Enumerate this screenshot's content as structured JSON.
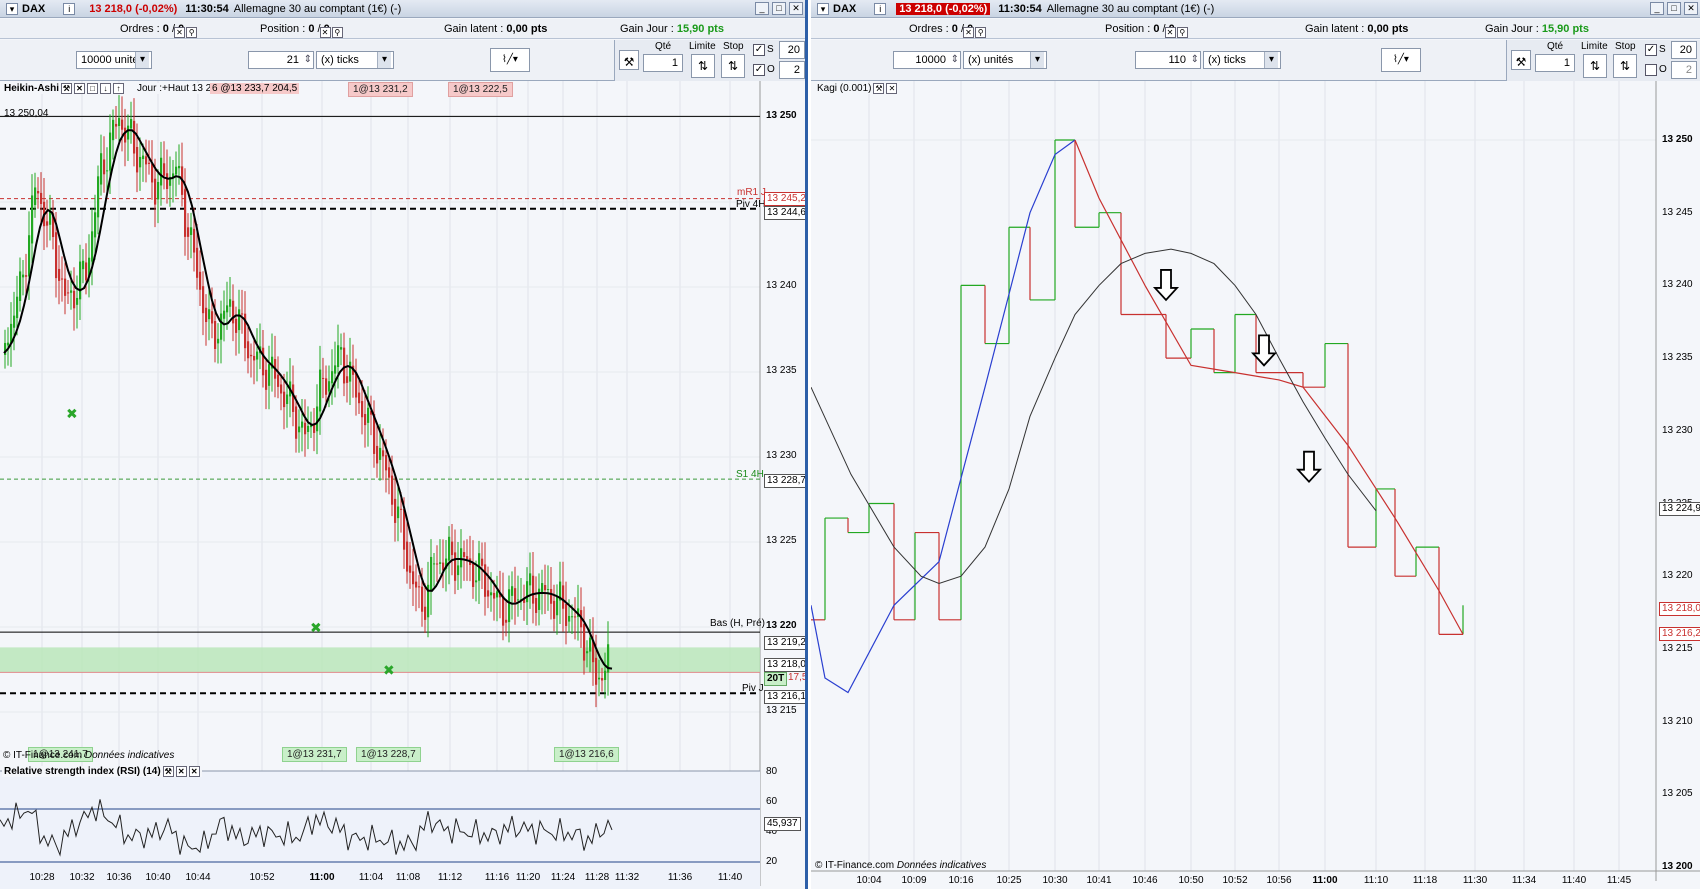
{
  "left": {
    "title": {
      "symbol": "DAX",
      "price": "13 218,0 (-0,02%)",
      "time": "11:30:54",
      "name": "Allemagne 30 au comptant (1€) (-)"
    },
    "info": {
      "ordres_label": "Ordres :",
      "ordres_val": "0",
      "ordres_val2": "0",
      "position_label": "Position :",
      "position_val": "0",
      "position_val2": "0",
      "gain_latent_label": "Gain latent :",
      "gain_latent_val": "0,00 pts",
      "gain_jour_label": "Gain Jour :",
      "gain_jour_val": "15,90 pts"
    },
    "toolbar": {
      "units": "10000 unités",
      "ticks_val": "21",
      "ticks_unit": "(x) ticks",
      "qte_label": "Qté",
      "qte_val": "1",
      "limite_label": "Limite",
      "stop_label": "Stop",
      "s_label": "S",
      "s_val": "20",
      "o_label": "O",
      "o_val": "2"
    },
    "chart_title": "Heikin-Ashi",
    "jour_label": "Jour :+Haut 13 29",
    "jour_label2": "6 @13 233,7 204,5",
    "tags_top": [
      "1@13 231,2",
      "1@13 222,5"
    ],
    "tags_bottom": [
      "1@13 241,7",
      "1@13 231,7",
      "1@13 228,7",
      "1@13 216,6"
    ],
    "level_label": "13 250,04",
    "line_labels": {
      "mr1": "mR1 J",
      "piv4h": "Piv 4H",
      "s14h": "S1 4H",
      "bas": "Bas (H, Pré)",
      "pivj": "Piv J"
    },
    "y_labels": [
      "13 250",
      "13 245",
      "13 240",
      "13 235",
      "13 230",
      "13 225",
      "13 220",
      "13 215"
    ],
    "price_boxes": [
      "13 245,2",
      "13 244,6",
      "13 228,7",
      "13 219,2",
      "13 218,0",
      "13 216,1"
    ],
    "box_20t": "20T",
    "box_175": "17,5",
    "copyright": "© IT-Finance.com",
    "copyright2": "Données indicatives",
    "rsi_title": "Relative strength index (RSI) (14)",
    "rsi_labels": [
      "80",
      "60",
      "40",
      "20"
    ],
    "rsi_box": "45,937",
    "x_labels": [
      "10:28",
      "10:32",
      "10:36",
      "10:40",
      "10:44",
      "10:52",
      "11:00",
      "11:04",
      "11:08",
      "11:12",
      "11:16",
      "11:20",
      "11:24",
      "11:28",
      "11:32",
      "11:36",
      "11:40"
    ]
  },
  "right": {
    "title": {
      "symbol": "DAX",
      "price": "13 218,0 (-0,02%)",
      "time": "11:30:54",
      "name": "Allemagne 30 au comptant (1€) (-)"
    },
    "info": {
      "ordres_label": "Ordres :",
      "ordres_val": "0",
      "ordres_val2": "0",
      "position_label": "Position :",
      "position_val": "0",
      "position_val2": "0",
      "gain_latent_label": "Gain latent :",
      "gain_latent_val": "0,00 pts",
      "gain_jour_label": "Gain Jour :",
      "gain_jour_val": "15,90 pts"
    },
    "toolbar": {
      "units_val": "10000",
      "units_unit": "(x) unités",
      "ticks_val": "110",
      "ticks_unit": "(x) ticks",
      "qte_label": "Qté",
      "qte_val": "1",
      "limite_label": "Limite",
      "stop_label": "Stop",
      "s_label": "S",
      "s_val": "20",
      "o_label": "O",
      "o_val": "2"
    },
    "chart_title": "Kagi (0.001)",
    "y_labels": [
      "13 250",
      "13 245",
      "13 240",
      "13 235",
      "13 230",
      "13 225",
      "13 220",
      "13 215",
      "13 210",
      "13 205",
      "13 200"
    ],
    "price_boxes": [
      "13 224,9",
      "13 218,0",
      "13 216,2"
    ],
    "copyright": "© IT-Finance.com",
    "copyright2": "Données indicatives",
    "x_labels": [
      "10:04",
      "10:09",
      "10:16",
      "10:25",
      "10:30",
      "10:41",
      "10:46",
      "10:50",
      "10:52",
      "10:56",
      "11:00",
      "11:10",
      "11:18",
      "11:30",
      "11:34",
      "11:40",
      "11:45"
    ]
  },
  "colors": {
    "up": "#22a822",
    "down": "#c8312f",
    "frame": "#2d5fa8"
  }
}
